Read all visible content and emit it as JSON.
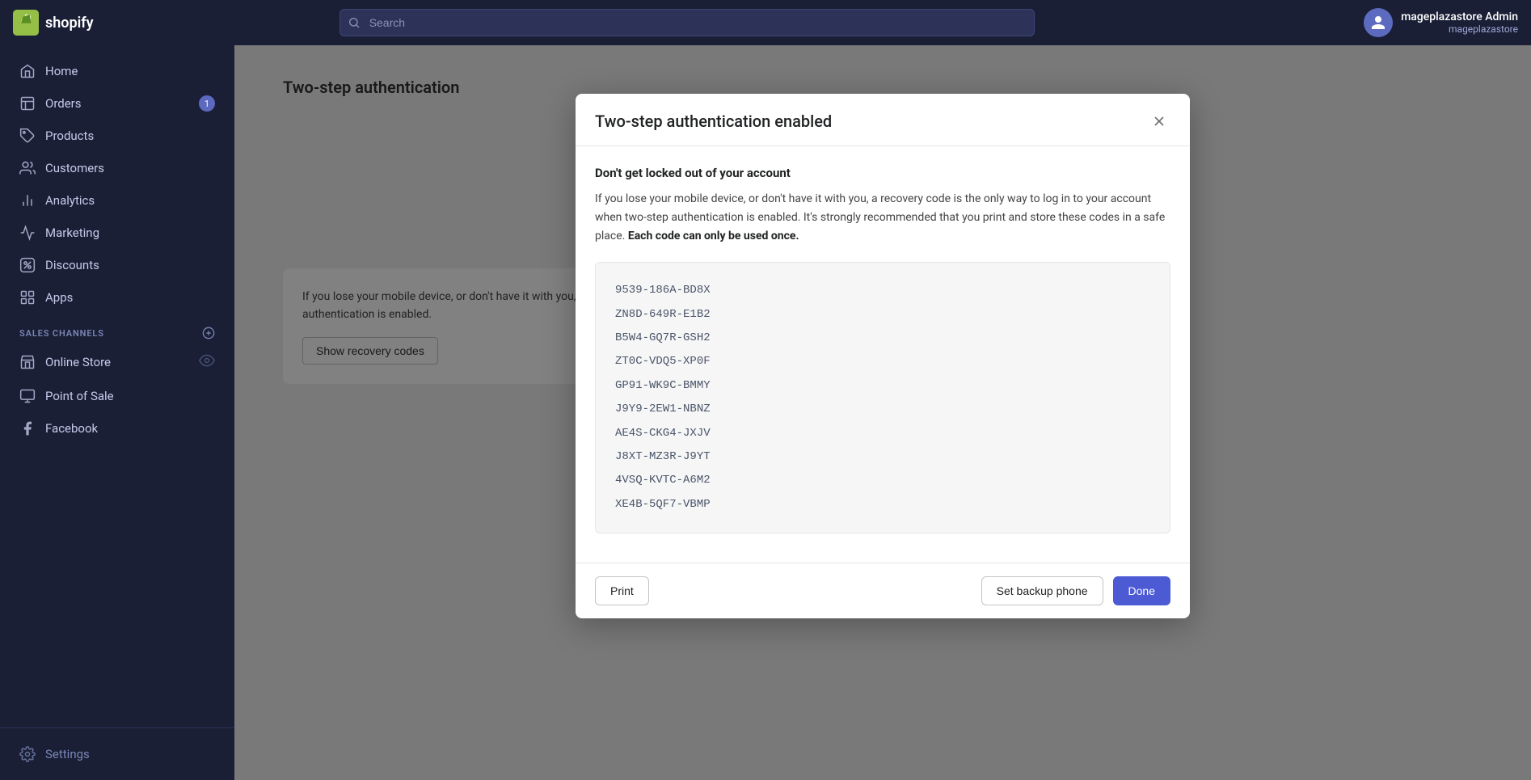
{
  "topnav": {
    "logo_text": "shopify",
    "search_placeholder": "Search",
    "user_name": "mageplazastore Admin",
    "user_store": "mageplazastore"
  },
  "sidebar": {
    "items": [
      {
        "id": "home",
        "label": "Home",
        "icon": "home-icon",
        "badge": null
      },
      {
        "id": "orders",
        "label": "Orders",
        "icon": "orders-icon",
        "badge": "1"
      },
      {
        "id": "products",
        "label": "Products",
        "icon": "products-icon",
        "badge": null
      },
      {
        "id": "customers",
        "label": "Customers",
        "icon": "customers-icon",
        "badge": null
      },
      {
        "id": "analytics",
        "label": "Analytics",
        "icon": "analytics-icon",
        "badge": null
      },
      {
        "id": "marketing",
        "label": "Marketing",
        "icon": "marketing-icon",
        "badge": null
      },
      {
        "id": "discounts",
        "label": "Discounts",
        "icon": "discounts-icon",
        "badge": null
      },
      {
        "id": "apps",
        "label": "Apps",
        "icon": "apps-icon",
        "badge": null
      }
    ],
    "sales_channels_label": "SALES CHANNELS",
    "channels": [
      {
        "id": "online-store",
        "label": "Online Store",
        "icon": "store-icon"
      },
      {
        "id": "point-of-sale",
        "label": "Point of Sale",
        "icon": "pos-icon"
      },
      {
        "id": "facebook",
        "label": "Facebook",
        "icon": "facebook-icon"
      }
    ],
    "settings_label": "Settings"
  },
  "bg": {
    "title": "Two-step authentication",
    "description_card": "If you lose your mobile device, or don't have it with you, a recovery code is the only way to log in to your account when two-step authentication is enabled.",
    "show_codes_btn": "Show recovery codes"
  },
  "modal": {
    "title": "Two-step authentication enabled",
    "close_label": "Close",
    "section_title": "Don't get locked out of your account",
    "description": "If you lose your mobile device, or don't have it with you, a recovery code is the only way to log in to your account when two-step authentication is enabled. It's strongly recommended that you print and store these codes in a safe place.",
    "description_bold": "Each code can only be used once.",
    "codes": [
      "9539-186A-BD8X",
      "ZN8D-649R-E1B2",
      "B5W4-GQ7R-GSH2",
      "ZT0C-VDQ5-XP0F",
      "GP91-WK9C-BMMY",
      "J9Y9-2EW1-NBNZ",
      "AE4S-CKG4-JXJV",
      "J8XT-MZ3R-J9YT",
      "4VSQ-KVTC-A6M2",
      "XE4B-5QF7-VBMP"
    ],
    "print_btn": "Print",
    "set_backup_phone_btn": "Set backup phone",
    "done_btn": "Done"
  }
}
